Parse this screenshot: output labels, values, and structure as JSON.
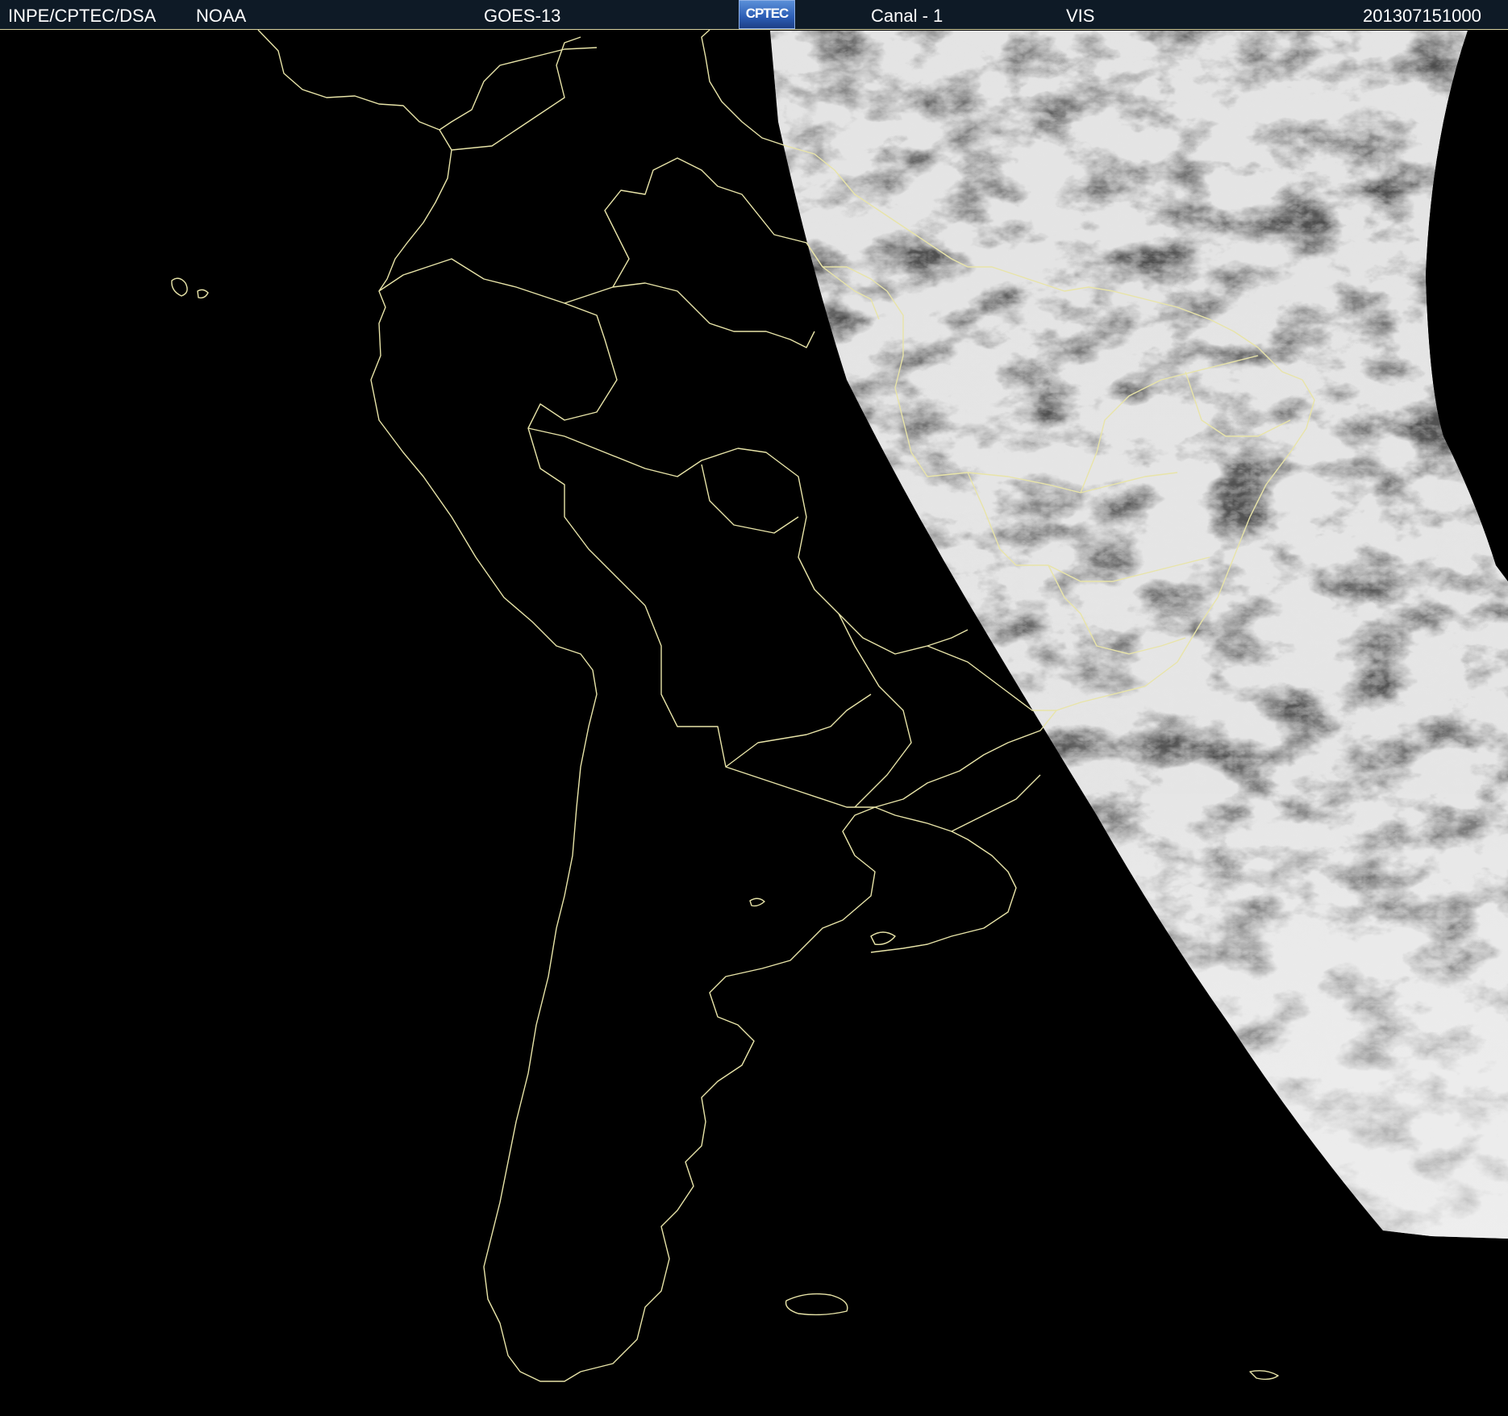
{
  "header": {
    "institution": "INPE/CPTEC/DSA",
    "agency": "NOAA",
    "satellite": "GOES-13",
    "logo_text": "CPTEC",
    "channel": "Canal - 1",
    "band": "VIS",
    "timestamp": "201307151000"
  },
  "colors": {
    "header_bg": "#0e1a26",
    "border_lines": "#e8e4a8",
    "background": "#000000"
  }
}
